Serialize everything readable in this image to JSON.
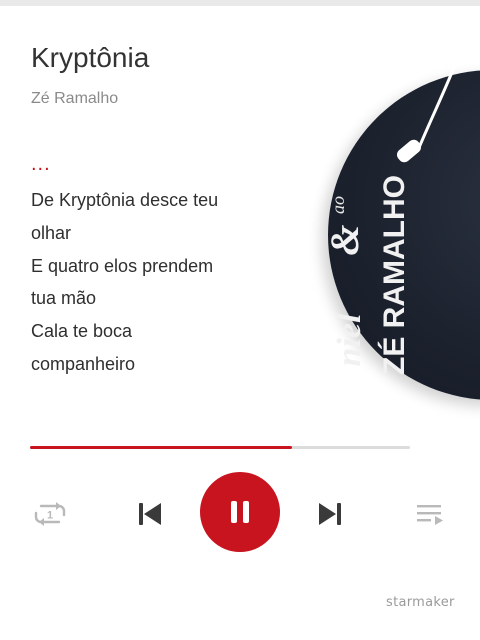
{
  "song": {
    "title": "Kryptônia",
    "artist": "Zé Ramalho"
  },
  "lyrics": {
    "ellipsis": "...",
    "lines": [
      "De Kryptônia desce teu",
      "olhar",
      "E quatro elos prendem",
      "tua mão",
      "Cala te boca",
      "companheiro"
    ]
  },
  "album_art": {
    "text_top": "ZÉ RAMALHO",
    "text_bottom": "ao",
    "ampersand": "&",
    "partial": "niel"
  },
  "playback": {
    "progress": 0.69,
    "state": "playing"
  },
  "controls": {
    "repeat_icon": "repeat-one-icon",
    "repeat_badge": "1",
    "prev_icon": "skip-previous-icon",
    "play_icon": "pause-icon",
    "next_icon": "skip-next-icon",
    "list_icon": "playlist-icon"
  },
  "branding": {
    "watermark": "starmaker"
  },
  "colors": {
    "accent": "#c8141f",
    "title": "#333333",
    "muted": "#8a8a8a",
    "icon_gray": "#b9b9b9",
    "icon_dark": "#3a3a3a"
  }
}
